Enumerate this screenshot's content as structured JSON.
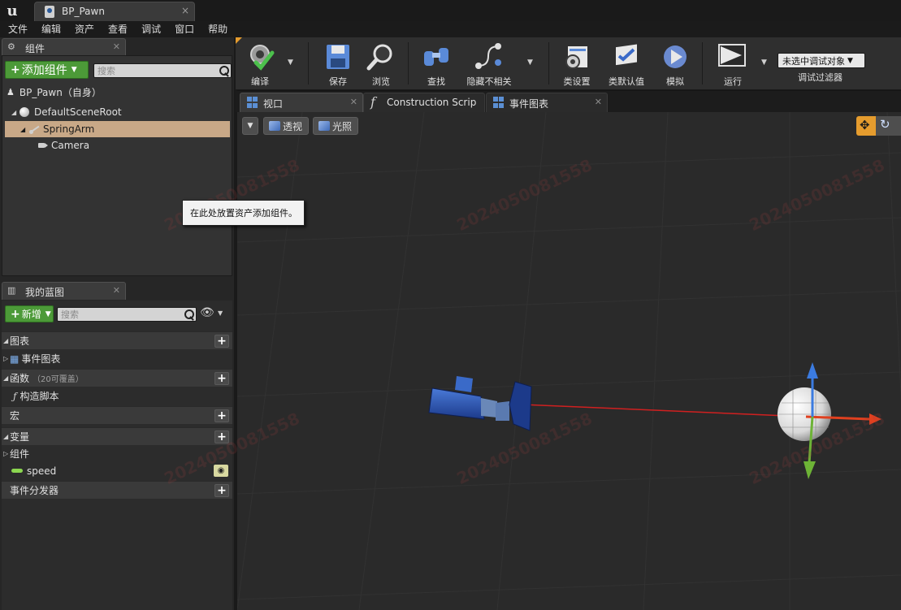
{
  "window": {
    "tab_title": "BP_Pawn",
    "close_glyph": "×"
  },
  "menu": [
    "文件",
    "编辑",
    "资产",
    "查看",
    "调试",
    "窗口",
    "帮助"
  ],
  "components_panel": {
    "tab_label": "组件",
    "add_button": "添加组件",
    "search_placeholder": "搜索",
    "self_label": "BP_Pawn（自身）",
    "tree": [
      {
        "label": "DefaultSceneRoot",
        "icon": "scene-root-icon"
      },
      {
        "label": "SpringArm",
        "icon": "spring-arm-icon",
        "selected": true
      },
      {
        "label": "Camera",
        "icon": "camera-icon"
      }
    ],
    "tooltip": "在此处放置资产添加组件。"
  },
  "blueprint_panel": {
    "tab_label": "我的蓝图",
    "new_button": "新增",
    "search_placeholder": "搜索",
    "sections": {
      "graphs": "图表",
      "event_graph": "事件图表",
      "functions": "函数",
      "functions_note": "（20可覆盖）",
      "construction_script": "构造脚本",
      "macros": "宏",
      "variables": "变量",
      "components": "组件",
      "speed": "speed",
      "event_dispatchers": "事件分发器"
    }
  },
  "toolbar": {
    "compile": "编译",
    "save": "保存",
    "browse": "浏览",
    "find": "查找",
    "hide_unrelated": "隐藏不相关",
    "class_settings": "类设置",
    "class_defaults": "类默认值",
    "simulate": "模拟",
    "play": "运行",
    "debug_object": "未选中调试对象",
    "debug_filter": "调试过滤器"
  },
  "editor_tabs": [
    "视口",
    "Construction Scrip",
    "事件图表"
  ],
  "viewport": {
    "perspective": "透视",
    "lit": "光照",
    "watermark": "2024050081558"
  },
  "colors": {
    "accent_green": "#4c9a38",
    "selection": "#c8a887",
    "gizmo_x": "#e0401f",
    "gizmo_y": "#6db336",
    "gizmo_z": "#3b7be0"
  }
}
